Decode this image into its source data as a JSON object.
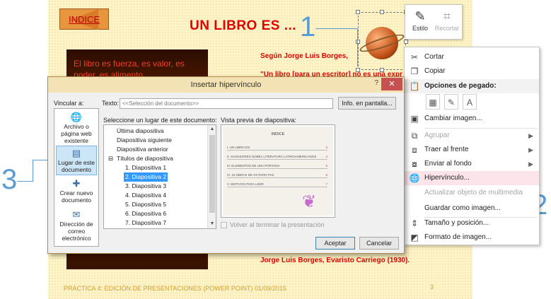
{
  "slide": {
    "index_label": "INDICE",
    "title": "UN LIBRO ES ...",
    "dark_text": "El libro es fuerza, es valor, es poder, es alimento.",
    "author": "Según Jorge Luis Borges,",
    "quote": "\"Un libro [para un escritor] no es una expr",
    "citation": "Jorge Luis Borges, Evaristo Carriego (1930).",
    "footer": "PRÁCTICA 4: EDICIÓN DE PRESENTACIONES (POWER POINT)   01/09/2015",
    "slide_number": "3"
  },
  "callouts": {
    "one": "1",
    "two": "2",
    "three": "3"
  },
  "mini_toolbar": {
    "style_label": "Estilo",
    "crop_label": "Recortar"
  },
  "context_menu": {
    "cut": "Cortar",
    "copy": "Copiar",
    "paste_header": "Opciones de pegado:",
    "change_image": "Cambiar imagen...",
    "group": "Agrupar",
    "bring_front": "Traer al frente",
    "send_back": "Enviar al fondo",
    "hyperlink": "Hipervínculo...",
    "update_media": "Actualizar objeto de multimedia",
    "save_as_image": "Guardar como imagen...",
    "size_position": "Tamaño y posición...",
    "format_image": "Formato de imagen..."
  },
  "dialog": {
    "title": "Insertar hipervínculo",
    "help": "?",
    "close": "✕",
    "link_to": "Vincular a:",
    "text_label": "Texto:",
    "text_value": "<<Selección del documento>>",
    "screentip_button": "Info. en pantalla...",
    "place_label": "Seleccione un lugar de este documento:",
    "preview_label": "Vista previa de diapositiva:",
    "link_options": [
      "Archivo o página web existente",
      "Lugar de este documento",
      "Crear nuevo documento",
      "Dirección de correo electrónico"
    ],
    "tree": [
      "Última diapositiva",
      "Diapositiva siguiente",
      "Diapositiva anterior",
      "Títulos de diapositiva",
      "1. Diapositiva 1",
      "2. Diapositiva 2",
      "3. Diapositiva 3",
      "4. Diapositiva 4",
      "5. Diapositiva 5",
      "6. Diapositiva 6",
      "7. Diapositiva 7"
    ],
    "show_and_return": "Volver al terminar la presentación",
    "ok": "Aceptar",
    "cancel": "Cancelar",
    "preview": {
      "title": "INDICE",
      "rows": [
        {
          "label": "I.   UN LIBRO ES",
          "num": "3"
        },
        {
          "label": "II.  GANADORES NOBEL LITERATURA LATINOAMERICANOS",
          "num": "4"
        },
        {
          "label": "III. ELEMENTOS DE UNA PORTADA",
          "num": "5"
        },
        {
          "label": "IV.  10 OBRAS DE OCTAVIO PAZ",
          "num": "6"
        },
        {
          "label": "V.   MOTIVOS PARA LEER",
          "num": "7"
        }
      ]
    }
  }
}
